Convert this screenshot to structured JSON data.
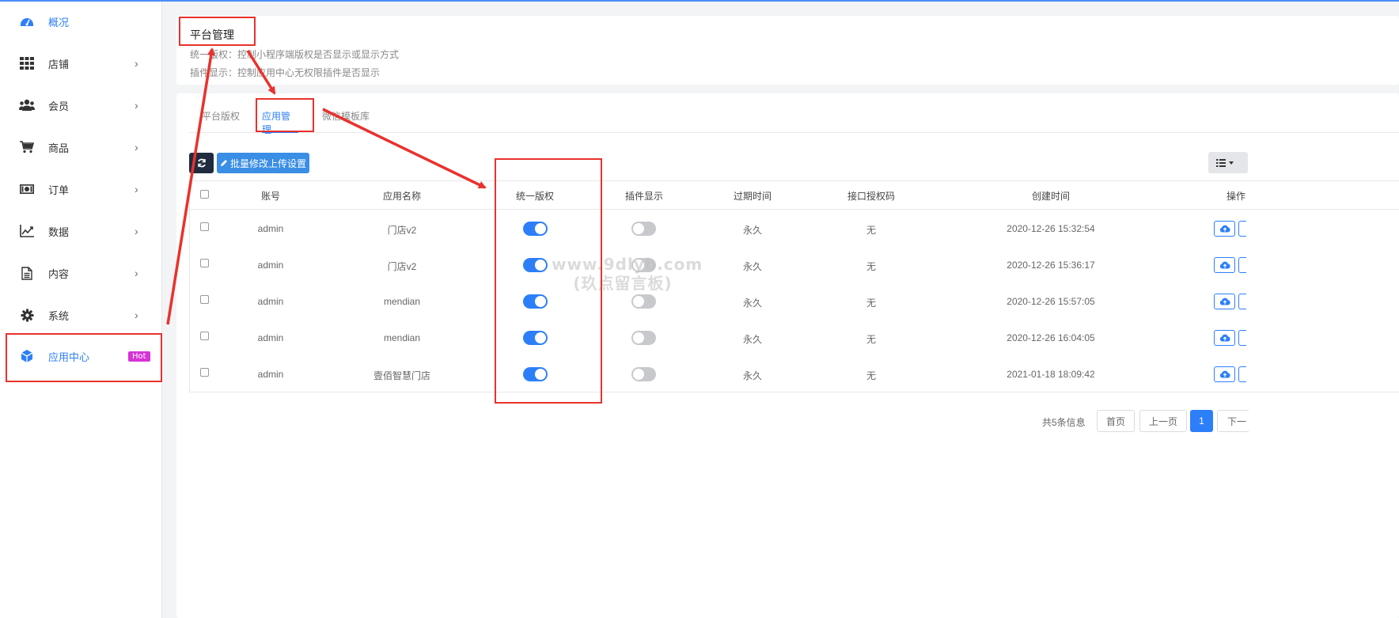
{
  "sidebar": {
    "items": [
      {
        "label": "概况",
        "icon": "dashboard-icon",
        "active": true
      },
      {
        "label": "店铺",
        "icon": "grid-icon"
      },
      {
        "label": "会员",
        "icon": "users-icon"
      },
      {
        "label": "商品",
        "icon": "cart-icon"
      },
      {
        "label": "订单",
        "icon": "money-icon"
      },
      {
        "label": "数据",
        "icon": "chart-line-icon"
      },
      {
        "label": "内容",
        "icon": "document-icon"
      },
      {
        "label": "系统",
        "icon": "gear-icon"
      },
      {
        "label": "应用中心",
        "icon": "cube-icon",
        "badge": "Hot",
        "active": true
      }
    ],
    "arrow": "›"
  },
  "info": {
    "title": "平台管理",
    "line1": "统一版权：控制小程序端版权是否显示或显示方式",
    "line2": "插件显示：控制应用中心无权限插件是否显示"
  },
  "tabs": [
    {
      "label": "平台版权"
    },
    {
      "label": "应用管理",
      "active": true
    },
    {
      "label": "微信模板库"
    }
  ],
  "toolbar": {
    "batch_label": "批量修改上传设置"
  },
  "table": {
    "columns": [
      "账号",
      "应用名称",
      "统一版权",
      "插件显示",
      "过期时间",
      "接口授权码",
      "创建时间",
      "操作"
    ],
    "rows": [
      {
        "account": "admin",
        "app": "门店v2",
        "copyright": true,
        "plugin": false,
        "expire": "永久",
        "code": "无",
        "created": "2020-12-26 15:32:54"
      },
      {
        "account": "admin",
        "app": "门店v2",
        "copyright": true,
        "plugin": false,
        "expire": "永久",
        "code": "无",
        "created": "2020-12-26 15:36:17"
      },
      {
        "account": "admin",
        "app": "mendian",
        "copyright": true,
        "plugin": false,
        "expire": "永久",
        "code": "无",
        "created": "2020-12-26 15:57:05"
      },
      {
        "account": "admin",
        "app": "mendian",
        "copyright": true,
        "plugin": false,
        "expire": "永久",
        "code": "无",
        "created": "2020-12-26 16:04:05"
      },
      {
        "account": "admin",
        "app": "壹佰智慧门店",
        "copyright": true,
        "plugin": false,
        "expire": "永久",
        "code": "无",
        "created": "2021-01-18 18:09:42"
      }
    ]
  },
  "pager": {
    "info": "共5条信息",
    "first": "首页",
    "prev": "上一页",
    "current": "1",
    "next": "下一"
  },
  "watermark": {
    "line1": "www.9dlyb.com",
    "line2": "(玖点留言板)"
  },
  "colors": {
    "accent": "#2d7ff9",
    "annotation": "#e8322d",
    "badge": "#d633d6"
  }
}
